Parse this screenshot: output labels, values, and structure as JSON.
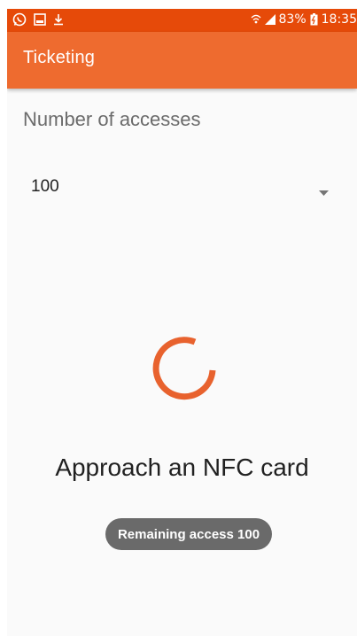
{
  "status_bar": {
    "battery": "83%",
    "time": "18:35",
    "icons": [
      "whatsapp-icon",
      "gallery-icon",
      "download-icon",
      "wifi-icon",
      "signal-icon",
      "battery-icon"
    ]
  },
  "app_bar": {
    "title": "Ticketing"
  },
  "accesses": {
    "label": "Number of accesses",
    "selected_value": "100"
  },
  "nfc": {
    "message": "Approach an NFC card"
  },
  "toast": {
    "text": "Remaining access 100"
  },
  "colors": {
    "status_bar": "#e64a09",
    "app_bar": "#ee6b2f",
    "accent": "#e8622e",
    "background": "#fafafa",
    "toast_bg": "#6a6a6a"
  }
}
